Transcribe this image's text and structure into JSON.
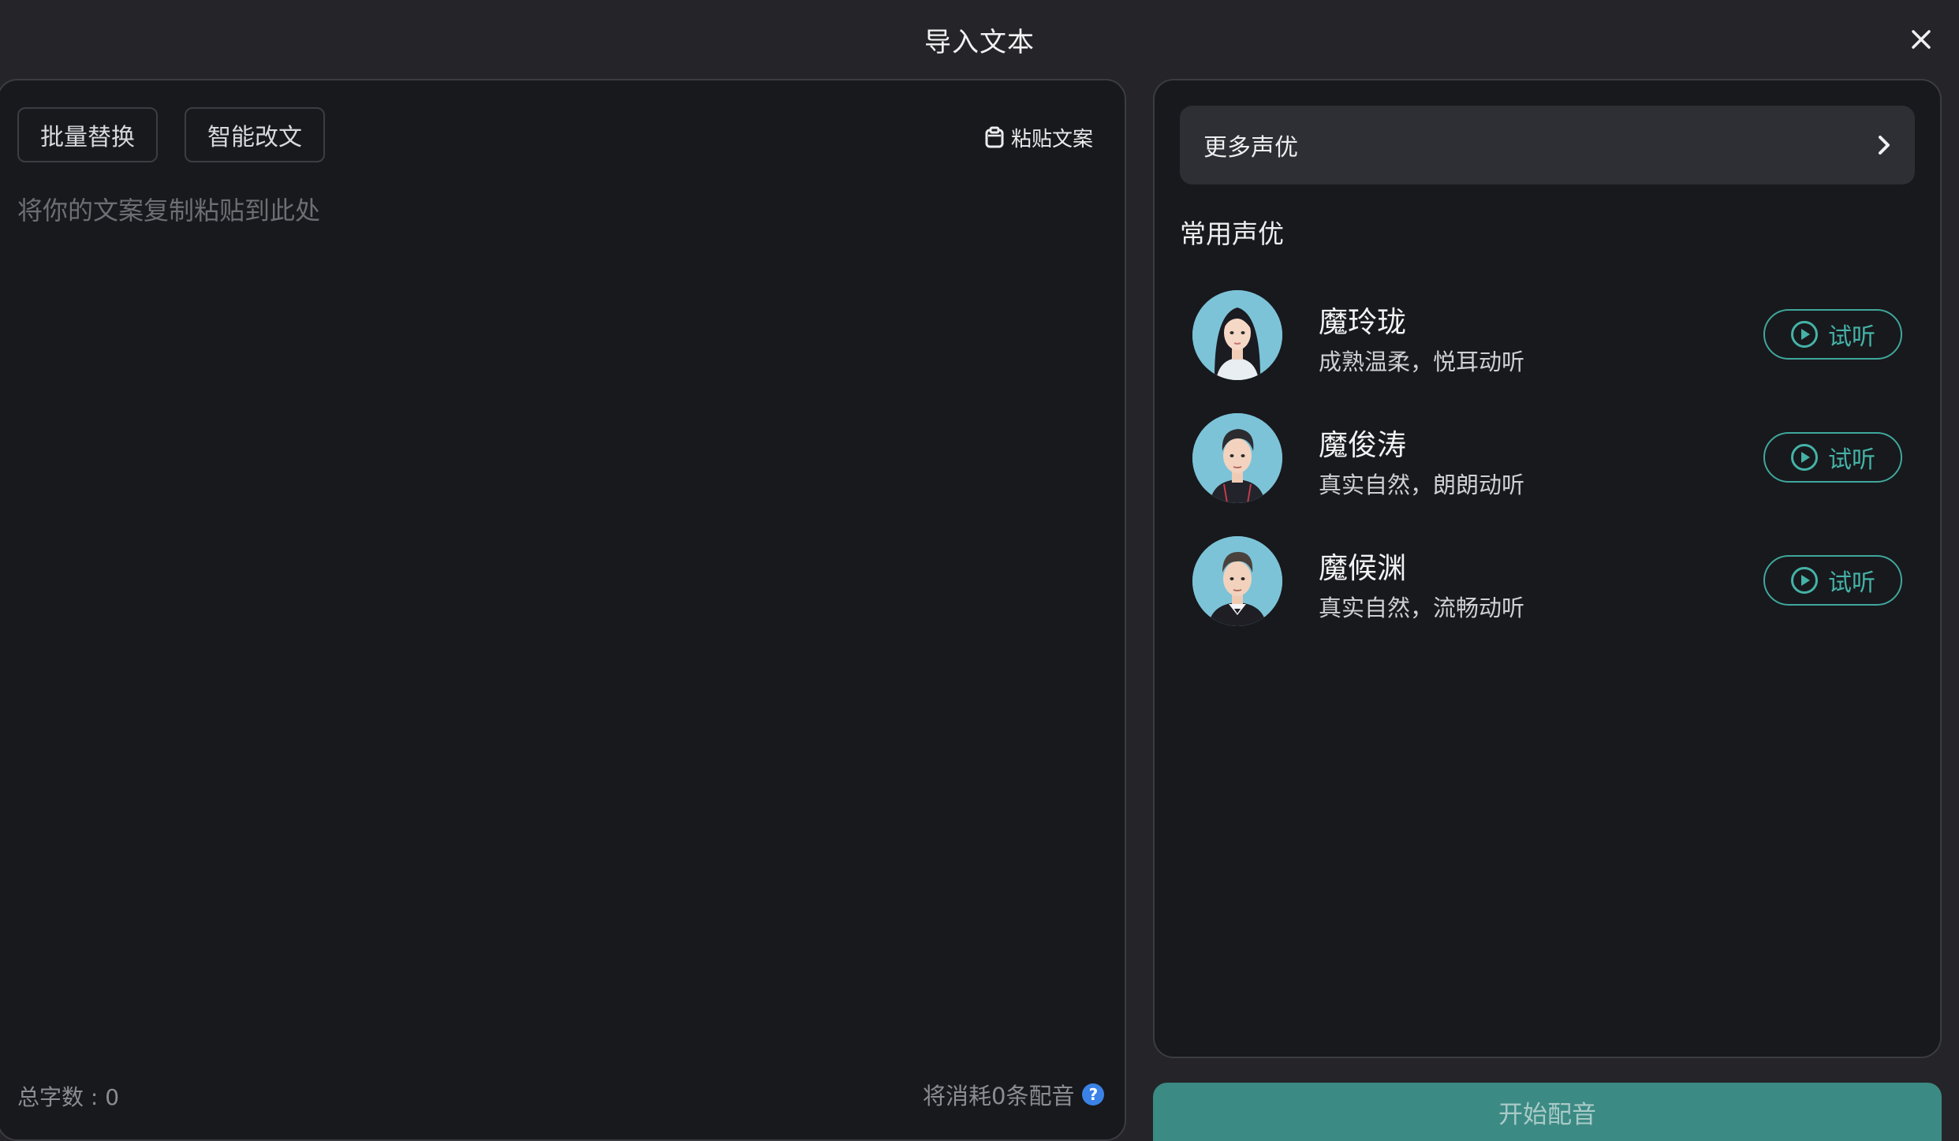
{
  "dialog": {
    "title": "导入文本",
    "close_icon": "close-icon"
  },
  "editor": {
    "batch_replace_label": "批量替换",
    "smart_rewrite_label": "智能改文",
    "paste_label": "粘贴文案",
    "placeholder": "将你的文案复制粘贴到此处",
    "value": "",
    "char_count_text": "总字数 : 0",
    "consume_text": "将消耗0条配音",
    "help_icon": "question-icon"
  },
  "voices": {
    "more_label": "更多声优",
    "section_title": "常用声优",
    "items": [
      {
        "name": "魔玲珑",
        "desc": "成熟温柔，悦耳动听",
        "listen_label": "试听",
        "avatar": "female-avatar"
      },
      {
        "name": "魔俊涛",
        "desc": "真实自然，朗朗动听",
        "listen_label": "试听",
        "avatar": "male-avatar-young"
      },
      {
        "name": "魔候渊",
        "desc": "真实自然，流畅动听",
        "listen_label": "试听",
        "avatar": "male-avatar-suit"
      }
    ]
  },
  "start_button_label": "开始配音",
  "colors": {
    "background": "#252529",
    "panel": "#18191d",
    "accent": "#44b3a7",
    "start_button": "#3c8a84",
    "help": "#3b82e6"
  }
}
